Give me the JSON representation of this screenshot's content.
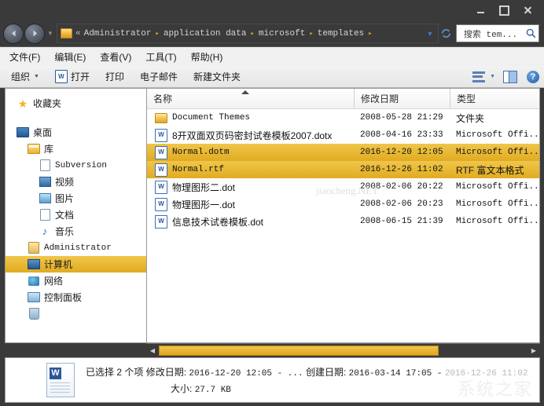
{
  "window": {
    "controls": {
      "minimize": "–",
      "maximize": "□",
      "close": "✕"
    }
  },
  "address": {
    "back_icon": "back-arrow-icon",
    "forward_icon": "forward-arrow-icon",
    "recent_dropdown_icon": "chevron-down-icon",
    "lead": "«",
    "crumbs": [
      "Administrator",
      "application data",
      "microsoft",
      "templates"
    ],
    "separator": "▸",
    "trailing_separator": "▸",
    "dropdown_icon": "chevron-down-icon",
    "refresh_icon": "refresh-icon"
  },
  "search": {
    "value": "搜索 tem...",
    "icon": "search-icon"
  },
  "menu": {
    "items": [
      {
        "label": "文件(F)"
      },
      {
        "label": "编辑(E)"
      },
      {
        "label": "查看(V)"
      },
      {
        "label": "工具(T)"
      },
      {
        "label": "帮助(H)"
      }
    ]
  },
  "toolbar": {
    "organize": "组织",
    "organize_caret": "▼",
    "open": "打开",
    "open_icon_letter": "W",
    "print": "打印",
    "email": "电子邮件",
    "new_folder": "新建文件夹",
    "view_icon": "list-view-icon",
    "view_caret": "▼",
    "preview_pane_icon": "preview-pane-icon",
    "help_icon": "?"
  },
  "sidebar": {
    "items": [
      {
        "label": "收藏夹",
        "icon": "star-icon",
        "indent": 14,
        "selected": false,
        "mono": false
      },
      {
        "label": "",
        "icon": "spacer",
        "indent": 0,
        "selected": false,
        "spacer": true,
        "mono": false
      },
      {
        "label": "桌面",
        "icon": "desktop-icon",
        "indent": 14,
        "selected": false,
        "mono": false
      },
      {
        "label": "库",
        "icon": "library-icon",
        "indent": 28,
        "selected": false,
        "mono": false
      },
      {
        "label": "Subversion",
        "icon": "document-icon",
        "indent": 42,
        "selected": false,
        "mono": true
      },
      {
        "label": "视频",
        "icon": "video-icon",
        "indent": 42,
        "selected": false,
        "mono": false
      },
      {
        "label": "图片",
        "icon": "picture-icon",
        "indent": 42,
        "selected": false,
        "mono": false
      },
      {
        "label": "文档",
        "icon": "document-icon",
        "indent": 42,
        "selected": false,
        "mono": false
      },
      {
        "label": "音乐",
        "icon": "music-icon",
        "indent": 42,
        "selected": false,
        "mono": false
      },
      {
        "label": "Administrator",
        "icon": "user-icon",
        "indent": 28,
        "selected": false,
        "mono": true
      },
      {
        "label": "计算机",
        "icon": "computer-icon",
        "indent": 28,
        "selected": true,
        "mono": false
      },
      {
        "label": "网络",
        "icon": "network-icon",
        "indent": 28,
        "selected": false,
        "mono": false
      },
      {
        "label": "控制面板",
        "icon": "control-panel-icon",
        "indent": 28,
        "selected": false,
        "mono": false
      },
      {
        "label": "",
        "icon": "recycle-bin-icon",
        "indent": 28,
        "selected": false,
        "mono": false
      }
    ]
  },
  "filelist": {
    "columns": [
      {
        "label": "名称",
        "sorted": "asc"
      },
      {
        "label": "修改日期",
        "sorted": ""
      },
      {
        "label": "类型",
        "sorted": ""
      }
    ],
    "sort_arrow": "▲",
    "rows": [
      {
        "name": "Document Themes",
        "date": "2008-05-28 21:29",
        "type": "文件夹",
        "icon": "folder-icon",
        "selected": false,
        "name_mono": true,
        "type_mono": false
      },
      {
        "name": "8开双面双页码密封试卷模板2007.dotx",
        "date": "2008-04-16 23:33",
        "type": "Microsoft Offi...",
        "icon": "word-icon",
        "selected": false,
        "name_mono": false,
        "type_mono": true
      },
      {
        "name": "Normal.dotm",
        "date": "2016-12-20 12:05",
        "type": "Microsoft Offi...",
        "icon": "word-icon",
        "selected": true,
        "name_mono": true,
        "type_mono": true
      },
      {
        "name": "Normal.rtf",
        "date": "2016-12-26 11:02",
        "type": "RTF 富文本格式",
        "icon": "word-icon",
        "selected": true,
        "name_mono": true,
        "type_mono": false
      },
      {
        "name": "物理图形二.dot",
        "date": "2008-02-06 20:22",
        "type": "Microsoft Offi...",
        "icon": "word-icon",
        "selected": false,
        "name_mono": false,
        "type_mono": true
      },
      {
        "name": "物理图形一.dot",
        "date": "2008-02-06 20:23",
        "type": "Microsoft Offi...",
        "icon": "word-icon",
        "selected": false,
        "name_mono": false,
        "type_mono": true
      },
      {
        "name": "信息技术试卷模板.dot",
        "date": "2008-06-15 21:39",
        "type": "Microsoft Offi...",
        "icon": "word-icon",
        "selected": false,
        "name_mono": false,
        "type_mono": true
      }
    ],
    "watermark": "jiaocheng.NET"
  },
  "hscroll": {
    "left_arrow": "◀",
    "right_arrow": "▶"
  },
  "status": {
    "icon": "word-document-icon",
    "icon_letter": "W",
    "selected_text": "已选择 2 个项",
    "modified_label": "修改日期:",
    "modified_value": "2016-12-20 12:05 - ...",
    "created_label": "创建日期:",
    "created_value": "2016-03-14 17:05 -",
    "created_value_faded": "2016-12-26 11:02",
    "size_label": "大小:",
    "size_value": "27.7 KB",
    "watermark": "系统之家"
  },
  "colors": {
    "chrome": "#3a3a3a",
    "selection": "#e0ab21",
    "accent_gold": "#efc44b",
    "pane_bg": "#ffffff",
    "toolbar_bg": "#f0f0f0"
  }
}
